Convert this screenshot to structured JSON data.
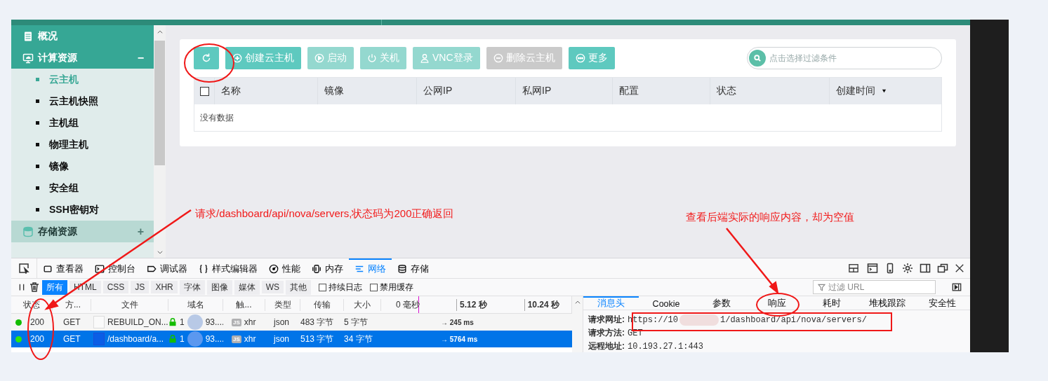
{
  "sidebar": {
    "items": [
      {
        "kind": "link",
        "label": "概况"
      },
      {
        "kind": "section",
        "label": "计算资源",
        "toggle": "−",
        "expanded": true,
        "children": [
          {
            "label": "云主机",
            "selected": true
          },
          {
            "label": "云主机快照",
            "selected": false
          },
          {
            "label": "主机组",
            "selected": false
          },
          {
            "label": "物理主机",
            "selected": false
          },
          {
            "label": "镜像",
            "selected": false
          },
          {
            "label": "安全组",
            "selected": false
          },
          {
            "label": "SSH密钥对",
            "selected": false
          }
        ]
      },
      {
        "kind": "section",
        "label": "存储资源",
        "toggle": "+",
        "expanded": false
      }
    ]
  },
  "toolbar": {
    "buttons": [
      {
        "disabled": false
      },
      {
        "label": "创建云主机",
        "disabled": false
      },
      {
        "label": "启动",
        "disabled": true
      },
      {
        "label": "关机",
        "disabled": true
      },
      {
        "label": "VNC登录",
        "disabled": true
      },
      {
        "label": "删除云主机",
        "disabled": true
      },
      {
        "label": "更多",
        "disabled": false
      }
    ],
    "search": {
      "placeholder": "点击选择过滤条件"
    }
  },
  "table": {
    "select_all": {
      "checked": false
    },
    "columns": [
      {
        "label": "名称",
        "sorted": false
      },
      {
        "label": "镜像",
        "sorted": false
      },
      {
        "label": "公网IP",
        "sorted": false
      },
      {
        "label": "私网IP",
        "sorted": false
      },
      {
        "label": "配置",
        "sorted": false
      },
      {
        "label": "状态",
        "sorted": false
      },
      {
        "label": "创建时间",
        "sorted": true
      }
    ],
    "empty_text": "没有数据"
  },
  "devtools": {
    "tabs": [
      {
        "label": "查看器",
        "selected": false
      },
      {
        "label": "控制台",
        "selected": false
      },
      {
        "label": "调试器",
        "selected": false
      },
      {
        "label": "样式编辑器",
        "selected": false
      },
      {
        "label": "性能",
        "selected": false
      },
      {
        "label": "内存",
        "selected": false
      },
      {
        "label": "网络",
        "selected": true
      },
      {
        "label": "存储",
        "selected": false
      }
    ],
    "filters": [
      {
        "label": "所有",
        "selected": true
      },
      {
        "label": "HTML",
        "selected": false
      },
      {
        "label": "CSS",
        "selected": false
      },
      {
        "label": "JS",
        "selected": false
      },
      {
        "label": "XHR",
        "selected": false
      },
      {
        "label": "字体",
        "selected": false
      },
      {
        "label": "图像",
        "selected": false
      },
      {
        "label": "媒体",
        "selected": false
      },
      {
        "label": "WS",
        "selected": false
      },
      {
        "label": "其他",
        "selected": false
      }
    ],
    "options": [
      {
        "label": "持续日志",
        "checked": false
      },
      {
        "label": "禁用缓存",
        "checked": false
      }
    ],
    "filter_url": {
      "placeholder": "过滤 URL"
    },
    "columns": [
      "状态",
      "方...",
      "文件",
      "域名",
      "触...",
      "类型",
      "传输",
      "大小"
    ],
    "timeline_ticks": [
      "0 毫秒",
      "5.12 秒",
      "10.24 秒"
    ],
    "requests": [
      {
        "status": "200",
        "method": "GET",
        "file": "REBUILD_ON...",
        "domain_parts": [
          "1",
          "93...."
        ],
        "cause_badge": "JS",
        "cause": "xhr",
        "type": "json",
        "transferred": "483 字节",
        "size": "5 字节",
        "timing": "→ 245 ms",
        "selected": false
      },
      {
        "status": "200",
        "method": "GET",
        "file": "/dashboard/a...",
        "domain_parts": [
          "1",
          "93...."
        ],
        "cause_badge": "JS",
        "cause": "xhr",
        "type": "json",
        "transferred": "513 字节",
        "size": "34 字节",
        "timing": "→ 5764 ms",
        "selected": true
      }
    ],
    "details": {
      "tabs": [
        {
          "label": "消息头",
          "selected": true
        },
        {
          "label": "Cookie",
          "selected": false
        },
        {
          "label": "参数",
          "selected": false
        },
        {
          "label": "响应",
          "selected": false
        },
        {
          "label": "耗时",
          "selected": false
        },
        {
          "label": "堆栈跟踪",
          "selected": false
        },
        {
          "label": "安全性",
          "selected": false
        }
      ],
      "fields": [
        {
          "label": "请求网址:",
          "parts": [
            "https://10",
            "1/dashboard/api/nova/servers/"
          ]
        },
        {
          "label": "请求方法:",
          "parts": [
            "GET"
          ]
        },
        {
          "label": "远程地址:",
          "parts": [
            "10.193.27.1:443"
          ]
        }
      ]
    }
  },
  "annotations": [
    {
      "text": "请求/dashboard/api/nova/servers,状态码为200正确返回"
    },
    {
      "text": "查看后端实际的响应内容，却为空值"
    }
  ]
}
